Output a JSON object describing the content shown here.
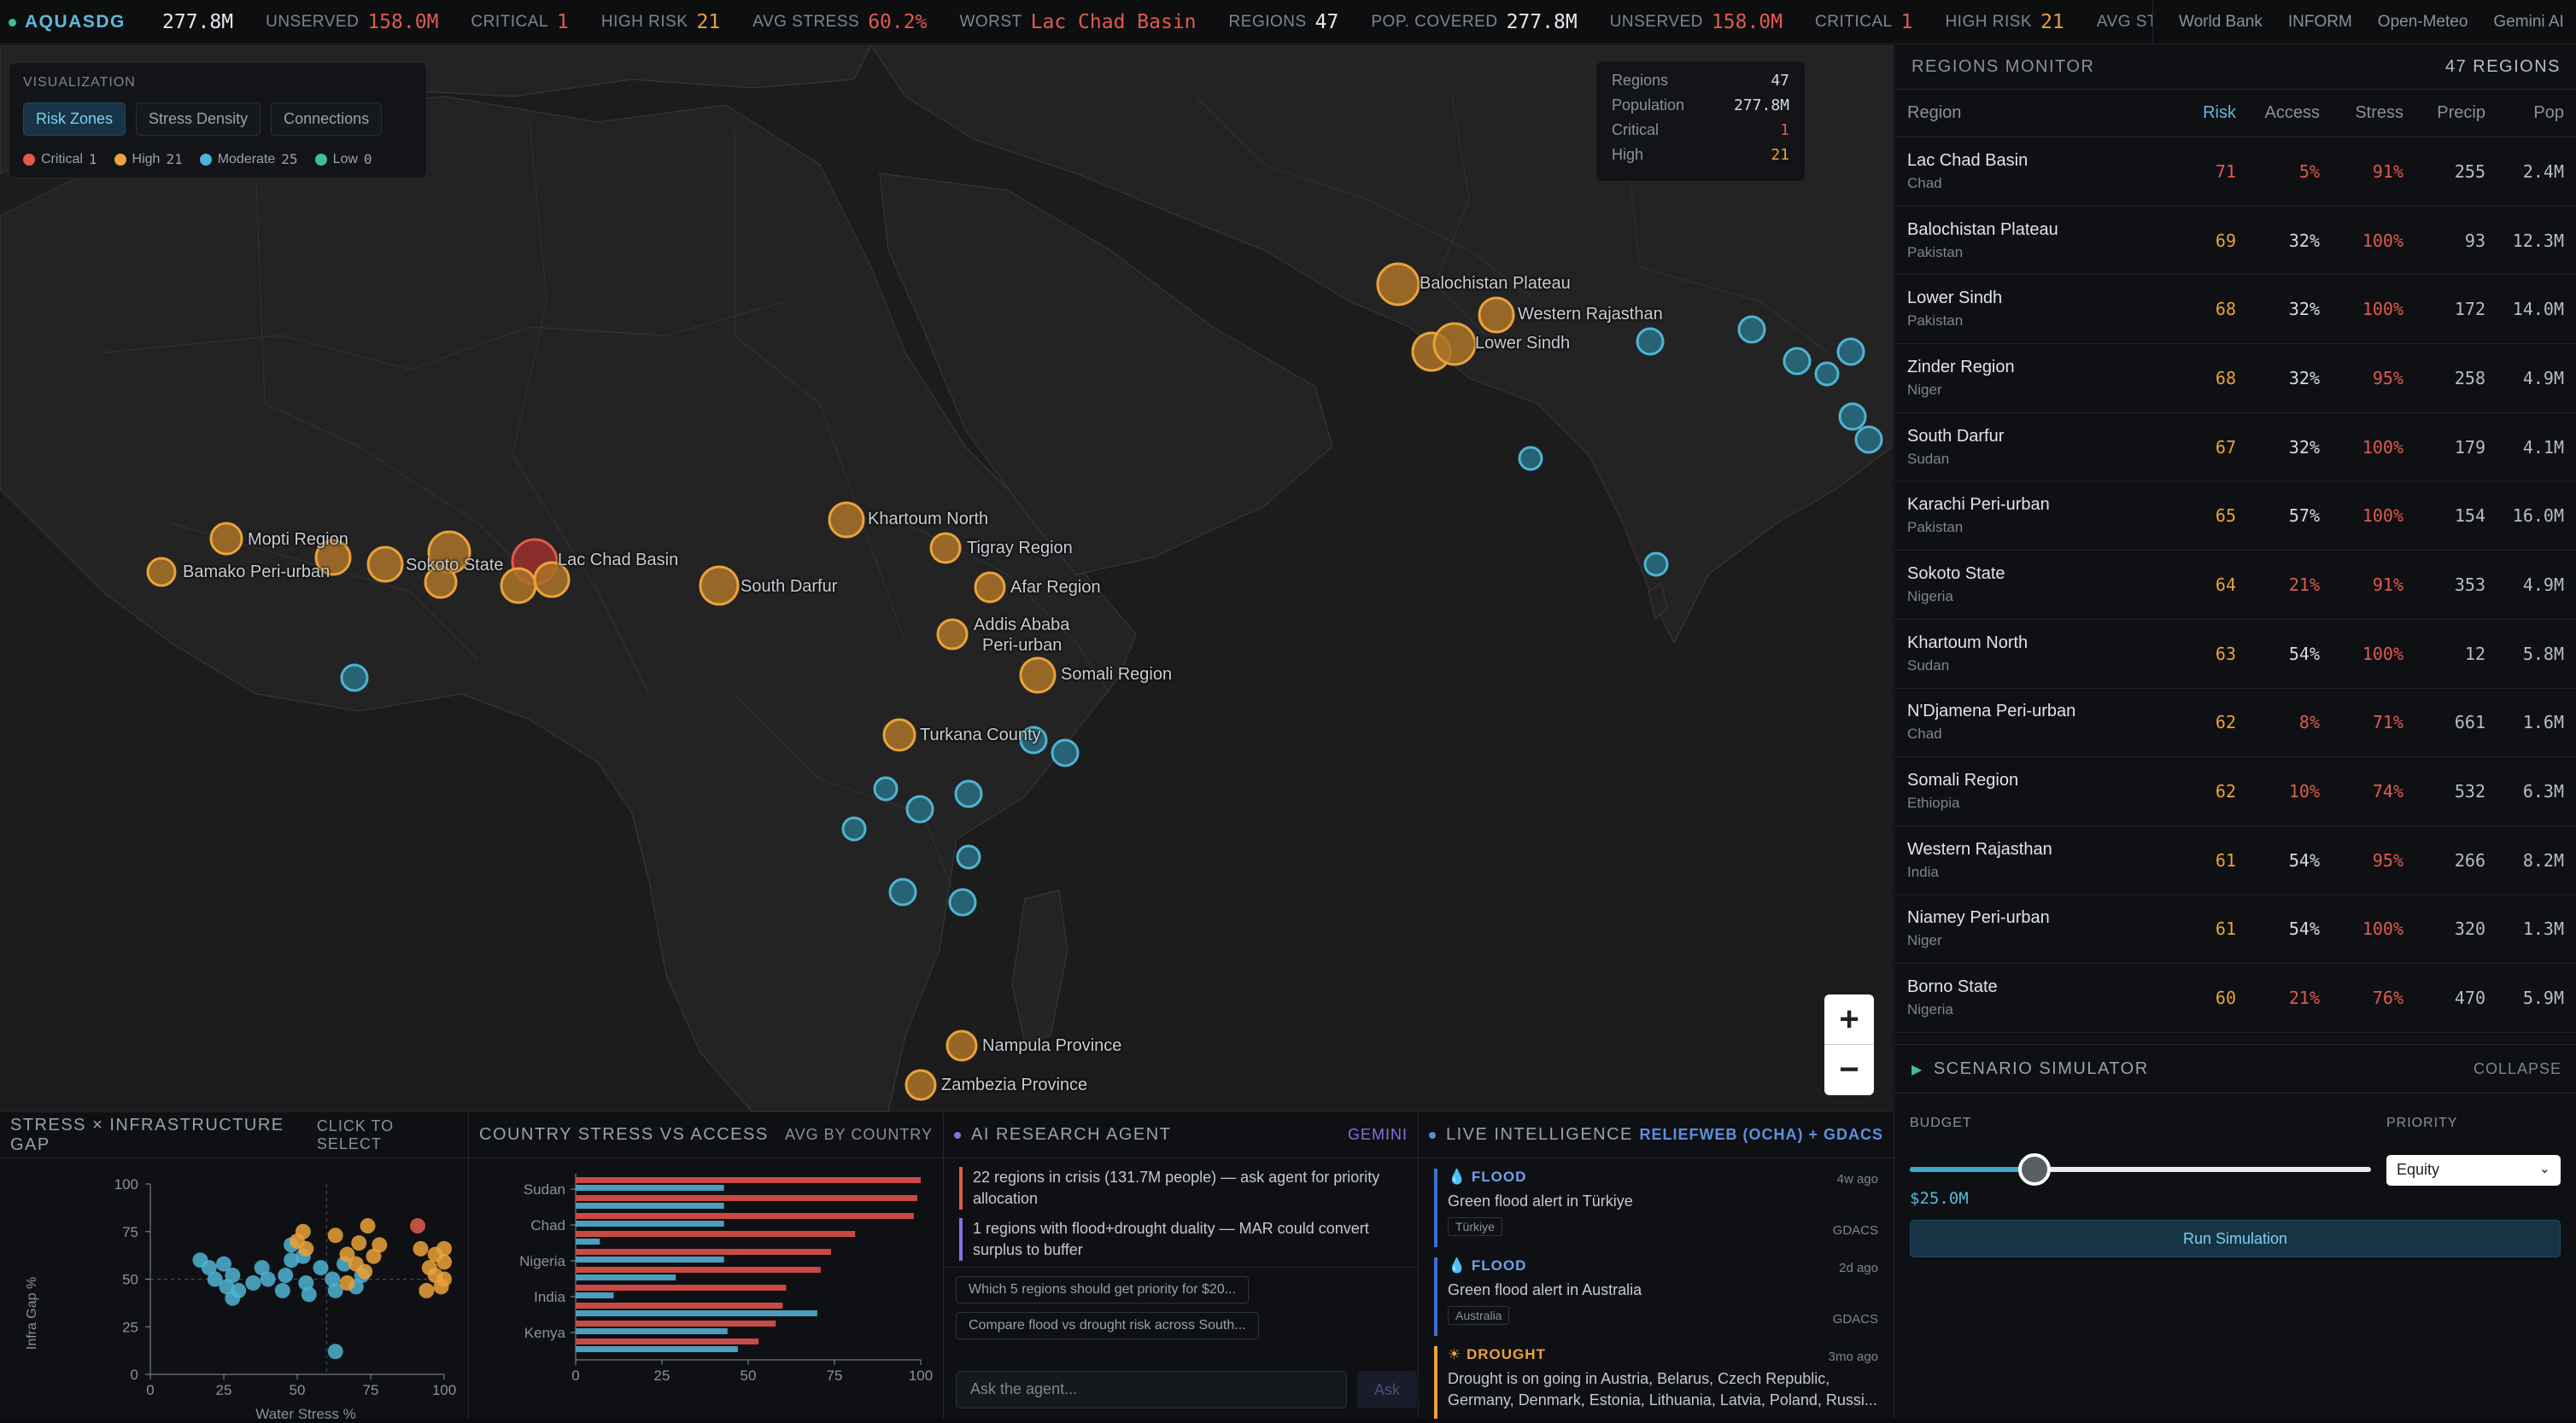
{
  "brand": "AQUASDG",
  "ticker": [
    {
      "label": "",
      "value": "277.8M",
      "color": "#e6e8eb"
    },
    {
      "label": "UNSERVED",
      "value": "158.0M",
      "color": "#e05a4e"
    },
    {
      "label": "CRITICAL",
      "value": "1",
      "color": "#e05a4e"
    },
    {
      "label": "HIGH RISK",
      "value": "21",
      "color": "#eaa23a"
    },
    {
      "label": "AVG STRESS",
      "value": "60.2%",
      "color": "#e05a4e"
    },
    {
      "label": "WORST",
      "value": "Lac Chad Basin",
      "color": "#e05a4e"
    },
    {
      "label": "REGIONS",
      "value": "47",
      "color": "#e6e8eb"
    },
    {
      "label": "POP. COVERED",
      "value": "277.8M",
      "color": "#e6e8eb"
    },
    {
      "label": "UNSERVED",
      "value": "158.0M",
      "color": "#e05a4e"
    },
    {
      "label": "CRITICAL",
      "value": "1",
      "color": "#e05a4e"
    },
    {
      "label": "HIGH RISK",
      "value": "21",
      "color": "#eaa23a"
    },
    {
      "label": "AVG STRESS",
      "value": "",
      "color": "#e6e8eb"
    }
  ],
  "sources": [
    "World Bank",
    "INFORM",
    "Open-Meteo",
    "Gemini AI"
  ],
  "viz": {
    "title": "VISUALIZATION",
    "modes": [
      "Risk Zones",
      "Stress Density",
      "Connections"
    ],
    "active_mode": "Risk Zones",
    "legend": [
      {
        "label": "Critical",
        "count": "1",
        "color": "#e05a4e"
      },
      {
        "label": "High",
        "count": "21",
        "color": "#eaa23a"
      },
      {
        "label": "Moderate",
        "count": "25",
        "color": "#4fb3d2"
      },
      {
        "label": "Low",
        "count": "0",
        "color": "#3fbf8f"
      }
    ]
  },
  "stats": [
    {
      "label": "Regions",
      "value": "47",
      "color": "#d6dae0"
    },
    {
      "label": "Population",
      "value": "277.8M",
      "color": "#d6dae0"
    },
    {
      "label": "Critical",
      "value": "1",
      "color": "#e05a4e"
    },
    {
      "label": "High",
      "value": "21",
      "color": "#eaa23a"
    }
  ],
  "map_labels": [
    "Mopti Region",
    "Bamako Peri-urban",
    "Sokoto State",
    "Lac Chad Basin",
    "South Darfur",
    "Khartoum North",
    "Tigray Region",
    "Afar Region",
    "Addis Ababa",
    "Peri-urban",
    "Somali Region",
    "Turkana County",
    "Balochistan Plateau",
    "Western Rajasthan",
    "Lower Sindh",
    "Nampula Province",
    "Zambezia Province"
  ],
  "monitor": {
    "title": "REGIONS MONITOR",
    "count": "47 REGIONS",
    "columns": [
      "Region",
      "Risk",
      "Access",
      "Stress",
      "Precip",
      "Pop"
    ],
    "rows": [
      {
        "name": "Lac Chad Basin",
        "country": "Chad",
        "risk": "71",
        "access": "5%",
        "stress": "91%",
        "precip": "255",
        "pop": "2.4M",
        "access_color": "#e05a4e"
      },
      {
        "name": "Balochistan Plateau",
        "country": "Pakistan",
        "risk": "69",
        "access": "32%",
        "stress": "100%",
        "precip": "93",
        "pop": "12.3M",
        "access_color": "#d6dae0"
      },
      {
        "name": "Lower Sindh",
        "country": "Pakistan",
        "risk": "68",
        "access": "32%",
        "stress": "100%",
        "precip": "172",
        "pop": "14.0M",
        "access_color": "#d6dae0"
      },
      {
        "name": "Zinder Region",
        "country": "Niger",
        "risk": "68",
        "access": "32%",
        "stress": "95%",
        "precip": "258",
        "pop": "4.9M",
        "access_color": "#d6dae0"
      },
      {
        "name": "South Darfur",
        "country": "Sudan",
        "risk": "67",
        "access": "32%",
        "stress": "100%",
        "precip": "179",
        "pop": "4.1M",
        "access_color": "#d6dae0"
      },
      {
        "name": "Karachi Peri-urban",
        "country": "Pakistan",
        "risk": "65",
        "access": "57%",
        "stress": "100%",
        "precip": "154",
        "pop": "16.0M",
        "access_color": "#d6dae0"
      },
      {
        "name": "Sokoto State",
        "country": "Nigeria",
        "risk": "64",
        "access": "21%",
        "stress": "91%",
        "precip": "353",
        "pop": "4.9M",
        "access_color": "#e05a4e"
      },
      {
        "name": "Khartoum North",
        "country": "Sudan",
        "risk": "63",
        "access": "54%",
        "stress": "100%",
        "precip": "12",
        "pop": "5.8M",
        "access_color": "#d6dae0"
      },
      {
        "name": "N'Djamena Peri-urban",
        "country": "Chad",
        "risk": "62",
        "access": "8%",
        "stress": "71%",
        "precip": "661",
        "pop": "1.6M",
        "access_color": "#e05a4e"
      },
      {
        "name": "Somali Region",
        "country": "Ethiopia",
        "risk": "62",
        "access": "10%",
        "stress": "74%",
        "precip": "532",
        "pop": "6.3M",
        "access_color": "#e05a4e"
      },
      {
        "name": "Western Rajasthan",
        "country": "India",
        "risk": "61",
        "access": "54%",
        "stress": "95%",
        "precip": "266",
        "pop": "8.2M",
        "access_color": "#d6dae0"
      },
      {
        "name": "Niamey Peri-urban",
        "country": "Niger",
        "risk": "61",
        "access": "54%",
        "stress": "100%",
        "precip": "320",
        "pop": "1.3M",
        "access_color": "#d6dae0"
      },
      {
        "name": "Borno State",
        "country": "Nigeria",
        "risk": "60",
        "access": "21%",
        "stress": "76%",
        "precip": "470",
        "pop": "5.9M",
        "access_color": "#e05a4e"
      }
    ]
  },
  "simulator": {
    "title": "SCENARIO SIMULATOR",
    "collapse": "COLLAPSE",
    "budget_label": "BUDGET",
    "budget_value": "$25.0M",
    "budget_fraction": 0.27,
    "priority_label": "PRIORITY",
    "priority_value": "Equity",
    "run": "Run Simulation"
  },
  "scatter_panel": {
    "title": "STRESS × INFRASTRUCTURE GAP",
    "action": "CLICK TO SELECT"
  },
  "bars_panel": {
    "title": "COUNTRY STRESS VS ACCESS",
    "action": "AVG BY COUNTRY"
  },
  "agent": {
    "title": "AI RESEARCH AGENT",
    "tag": "GEMINI",
    "messages": [
      {
        "text": "22 regions in crisis (131.7M people) — ask agent for priority allocation",
        "color": "#e05a4e"
      },
      {
        "text": "1 regions with flood+drought duality — MAR could convert surplus to buffer",
        "color": "#8a6fe0"
      }
    ],
    "suggestions": [
      "Which 5 regions should get priority for $20...",
      "Compare flood vs drought risk across South..."
    ],
    "input_placeholder": "Ask the agent...",
    "ask": "Ask"
  },
  "intel": {
    "title": "LIVE INTELLIGENCE",
    "tag": "RELIEFWEB (OCHA) + GDACS",
    "items": [
      {
        "type": "FLOOD",
        "title": "Green flood alert in Türkiye",
        "tag": "Türkiye",
        "time": "4w ago",
        "source": "GDACS",
        "color": "#3b6fd0",
        "icon": "💧"
      },
      {
        "type": "FLOOD",
        "title": "Green flood alert in Australia",
        "tag": "Australia",
        "time": "2d ago",
        "source": "GDACS",
        "color": "#3b6fd0",
        "icon": "💧"
      },
      {
        "type": "DROUGHT",
        "title": "Drought is on going in Austria, Belarus, Czech Republic, Germany, Denmark, Estonia, Lithuania, Latvia, Poland, Russi...",
        "tag": "",
        "time": "3mo ago",
        "source": "",
        "color": "#eaa23a",
        "icon": "☀"
      }
    ]
  },
  "chart_data": [
    {
      "type": "scatter",
      "title": "STRESS × INFRASTRUCTURE GAP",
      "xlabel": "Water Stress %",
      "ylabel": "Infra Gap %",
      "xlim": [
        0,
        100
      ],
      "ylim": [
        0,
        100
      ],
      "xticks": [
        0,
        25,
        50,
        75,
        100
      ],
      "yticks": [
        0,
        25,
        50,
        75,
        100
      ],
      "series": [
        {
          "color": "#4fb3d2",
          "points": [
            [
              17,
              60
            ],
            [
              20,
              56
            ],
            [
              22,
              50
            ],
            [
              25,
              58
            ],
            [
              26,
              46
            ],
            [
              28,
              52
            ],
            [
              30,
              44
            ],
            [
              28,
              40
            ],
            [
              35,
              48
            ],
            [
              38,
              56
            ],
            [
              40,
              50
            ],
            [
              45,
              44
            ],
            [
              46,
              52
            ],
            [
              48,
              60
            ],
            [
              48,
              68
            ],
            [
              52,
              62
            ],
            [
              53,
              48
            ],
            [
              54,
              42
            ],
            [
              58,
              56
            ],
            [
              62,
              50
            ],
            [
              63,
              44
            ],
            [
              66,
              58
            ],
            [
              70,
              46
            ],
            [
              72,
              52
            ],
            [
              63,
              12
            ]
          ]
        },
        {
          "color": "#eaa23a",
          "points": [
            [
              52,
              75
            ],
            [
              50,
              70
            ],
            [
              53,
              66
            ],
            [
              63,
              73
            ],
            [
              67,
              63
            ],
            [
              71,
              69
            ],
            [
              74,
              78
            ],
            [
              76,
              62
            ],
            [
              78,
              68
            ],
            [
              70,
              58
            ],
            [
              73,
              54
            ],
            [
              92,
              66
            ],
            [
              97,
              63
            ],
            [
              100,
              59
            ],
            [
              97,
              52
            ],
            [
              100,
              50
            ],
            [
              99,
              46
            ],
            [
              94,
              44
            ],
            [
              95,
              56
            ],
            [
              100,
              66
            ],
            [
              67,
              48
            ]
          ]
        },
        {
          "color": "#e05a4e",
          "points": [
            [
              91,
              78
            ]
          ]
        }
      ]
    },
    {
      "type": "bar",
      "title": "COUNTRY STRESS VS ACCESS",
      "categories": [
        "Sudan",
        "",
        "Chad",
        "",
        "Nigeria",
        "",
        "India",
        "",
        "Kenya",
        ""
      ],
      "tick_categories": [
        "Sudan",
        "Chad",
        "Nigeria",
        "India",
        "Kenya"
      ],
      "xlim": [
        0,
        100
      ],
      "xticks": [
        0,
        25,
        50,
        75,
        100
      ],
      "series": [
        {
          "name": "Stress",
          "color": "#c94a44",
          "values": [
            100,
            99,
            98,
            81,
            74,
            71,
            61,
            60,
            58,
            53
          ]
        },
        {
          "name": "Access",
          "color": "#4a9ebe",
          "values": [
            43,
            43,
            43,
            7,
            43,
            29,
            11,
            70,
            44,
            47
          ]
        }
      ]
    }
  ]
}
